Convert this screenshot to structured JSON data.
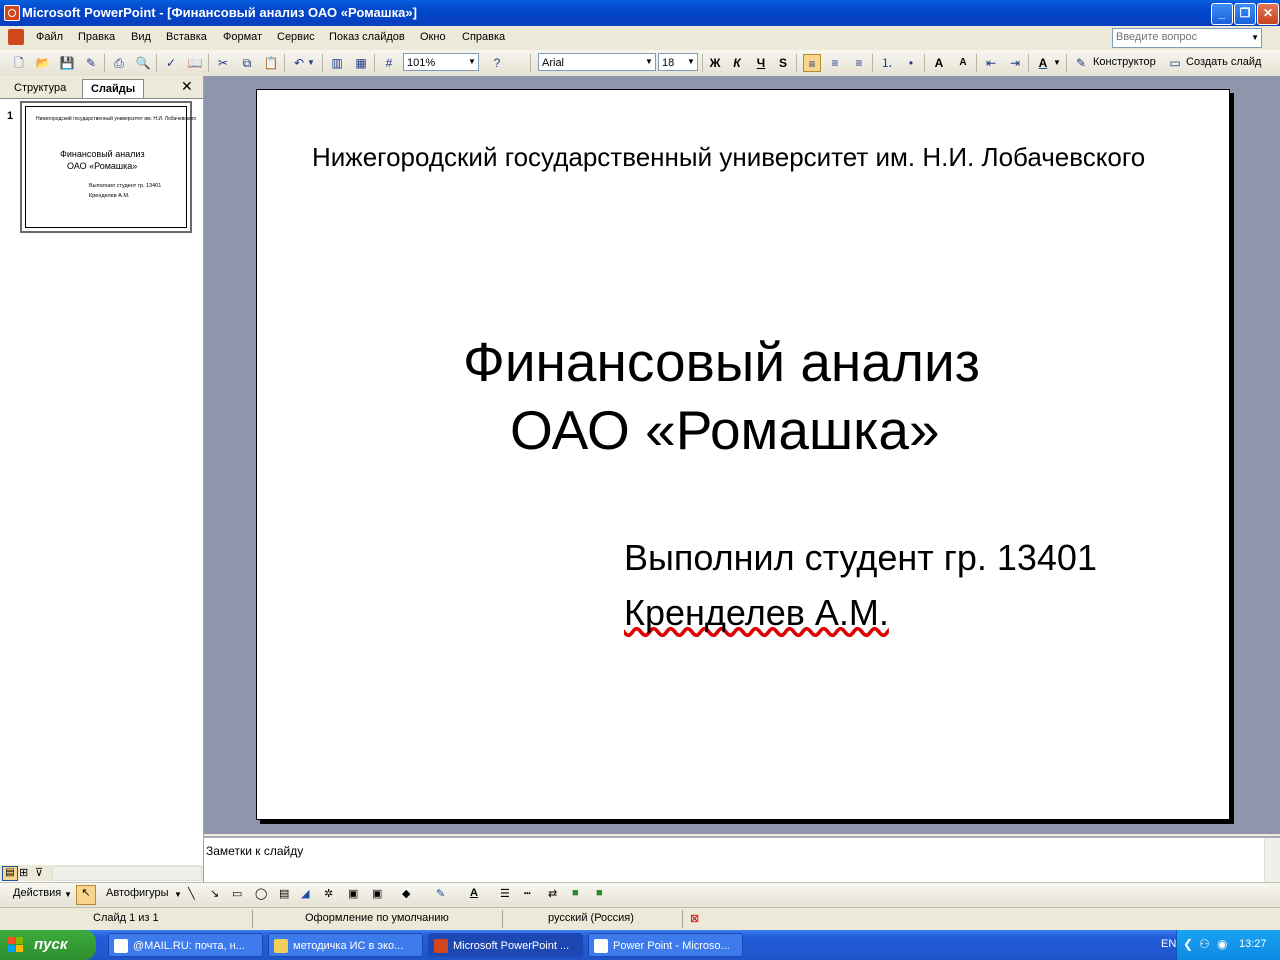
{
  "window": {
    "title": "Microsoft PowerPoint - [Финансовый анализ ОАО «Ромашка»]"
  },
  "menu": {
    "items": [
      "Файл",
      "Правка",
      "Вид",
      "Вставка",
      "Формат",
      "Сервис",
      "Показ слайдов",
      "Окно",
      "Справка"
    ],
    "help_placeholder": "Введите вопрос"
  },
  "toolbar": {
    "zoom": "101%",
    "font_name": "Arial",
    "font_size": "18",
    "bold": "Ж",
    "italic": "К",
    "underline": "Ч",
    "shadow": "S",
    "designer": "Конструктор",
    "new_slide": "Создать слайд"
  },
  "left_pane": {
    "tabs": [
      "Структура",
      "Слайды"
    ],
    "active_tab": "Слайды",
    "slide_number": "1"
  },
  "slide": {
    "university": "Нижегородский государственный университет им. Н.И. Лобачевского",
    "title_line1": "Финансовый анализ",
    "title_line2": "ОАО «Ромашка»",
    "author_line1": "Выполнил студент гр. 13401",
    "author_line2": "Кренделев А.М."
  },
  "notes": {
    "placeholder": "Заметки к слайду"
  },
  "draw_toolbar": {
    "actions": "Действия",
    "autoshapes": "Автофигуры"
  },
  "status": {
    "slide": "Слайд 1 из 1",
    "design": "Оформление по умолчанию",
    "language": "русский (Россия)"
  },
  "taskbar": {
    "start": "пуск",
    "tasks": [
      "@MAIL.RU: почта, н...",
      "методичка ИС в эко...",
      "Microsoft PowerPoint ...",
      "Power Point - Microso..."
    ],
    "lang": "EN",
    "clock": "13:27"
  },
  "colors": {
    "accent": "#0a5fde",
    "workspace": "#8d96aa",
    "start": "#2f8f2f"
  }
}
